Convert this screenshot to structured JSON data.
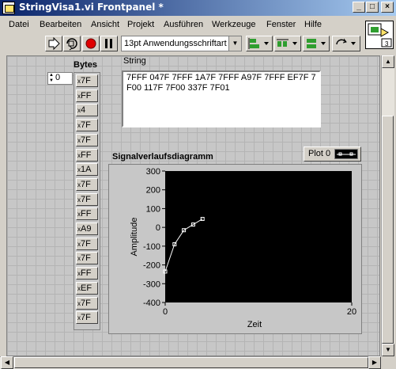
{
  "window": {
    "title": "StringVisa1.vi Frontpanel *",
    "buttons": {
      "minimize": "_",
      "maximize": "□",
      "close": "×"
    }
  },
  "menu": [
    "Datei",
    "Bearbeiten",
    "Ansicht",
    "Projekt",
    "Ausführen",
    "Werkzeuge",
    "Fenster",
    "Hilfe"
  ],
  "toolbar": {
    "font": "13pt Anwendungsschriftart",
    "icons": [
      "run-arrow-icon",
      "run-continuously-icon",
      "abort-icon",
      "pause-icon",
      "align-icon",
      "distribute-icon",
      "resize-icon",
      "reorder-icon"
    ]
  },
  "vi_icon_number": "3",
  "bytes": {
    "label": "Bytes",
    "index": "0",
    "values": [
      "7F",
      "FF",
      "4",
      "7F",
      "7F",
      "FF",
      "1A",
      "7F",
      "7F",
      "FF",
      "A9",
      "7F",
      "7F",
      "FF",
      "EF",
      "7F",
      "7F"
    ]
  },
  "string": {
    "label": "String",
    "value": "7FFF 047F 7FFF 1A7F 7FFF A97F 7FFF EF7F 7F00 117F 7F00 337F 7F01"
  },
  "chart_data": {
    "type": "line",
    "title": "Signalverlaufsdiagramm",
    "legend": "Plot 0",
    "xlabel": "Zeit",
    "ylabel": "Amplitude",
    "xlim": [
      0,
      20
    ],
    "ylim": [
      -400,
      300
    ],
    "xticks": [
      "0",
      "20"
    ],
    "yticks": [
      "300",
      "200",
      "100",
      "0",
      "-100",
      "-200",
      "-300",
      "-400"
    ],
    "series": [
      {
        "name": "Plot 0",
        "x": [
          0,
          1,
          2,
          3,
          4
        ],
        "y": [
          -235,
          -90,
          -15,
          15,
          45
        ]
      }
    ],
    "background": "#000000",
    "line_color": "#ffffff"
  }
}
